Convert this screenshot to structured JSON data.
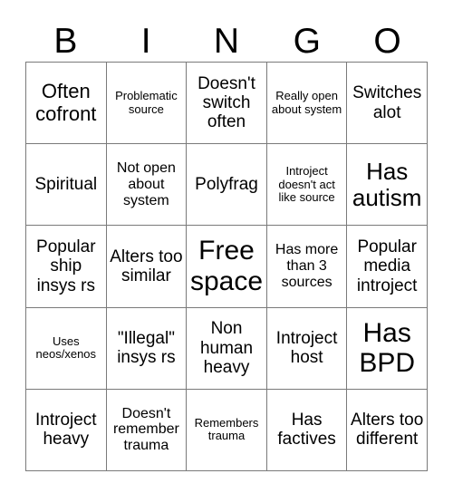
{
  "card": {
    "title_letters": [
      "B",
      "I",
      "N",
      "G",
      "O"
    ],
    "colors": {
      "text": "#000000",
      "grid_border": "#7a7a7a",
      "background": "#ffffff"
    },
    "columns": 5,
    "rows": 5,
    "free_space_label": "Free space",
    "cells": [
      {
        "text": "Often cofront",
        "size": "lg"
      },
      {
        "text": "Problematic source",
        "size": "xs"
      },
      {
        "text": "Doesn't switch often",
        "size": "md"
      },
      {
        "text": "Really open about system",
        "size": "xs"
      },
      {
        "text": "Switches alot",
        "size": "md"
      },
      {
        "text": "Spiritual",
        "size": "md"
      },
      {
        "text": "Not open about system",
        "size": "sm"
      },
      {
        "text": "Polyfrag",
        "size": "md"
      },
      {
        "text": "Introject doesn't act like source",
        "size": "xs"
      },
      {
        "text": "Has autism",
        "size": "xl"
      },
      {
        "text": "Popular ship insys rs",
        "size": "md"
      },
      {
        "text": "Alters too similar",
        "size": "md"
      },
      {
        "text": "Free space",
        "size": "xxl"
      },
      {
        "text": "Has more than 3 sources",
        "size": "sm"
      },
      {
        "text": "Popular media introject",
        "size": "md"
      },
      {
        "text": "Uses neos/xenos",
        "size": "xs"
      },
      {
        "text": "\"Illegal\" insys rs",
        "size": "md"
      },
      {
        "text": "Non human heavy",
        "size": "md"
      },
      {
        "text": "Introject host",
        "size": "md"
      },
      {
        "text": "Has BPD",
        "size": "xxl"
      },
      {
        "text": "Introject heavy",
        "size": "md"
      },
      {
        "text": "Doesn't remember trauma",
        "size": "sm"
      },
      {
        "text": "Remembers trauma",
        "size": "xs"
      },
      {
        "text": "Has factives",
        "size": "md"
      },
      {
        "text": "Alters too different",
        "size": "md"
      }
    ]
  }
}
